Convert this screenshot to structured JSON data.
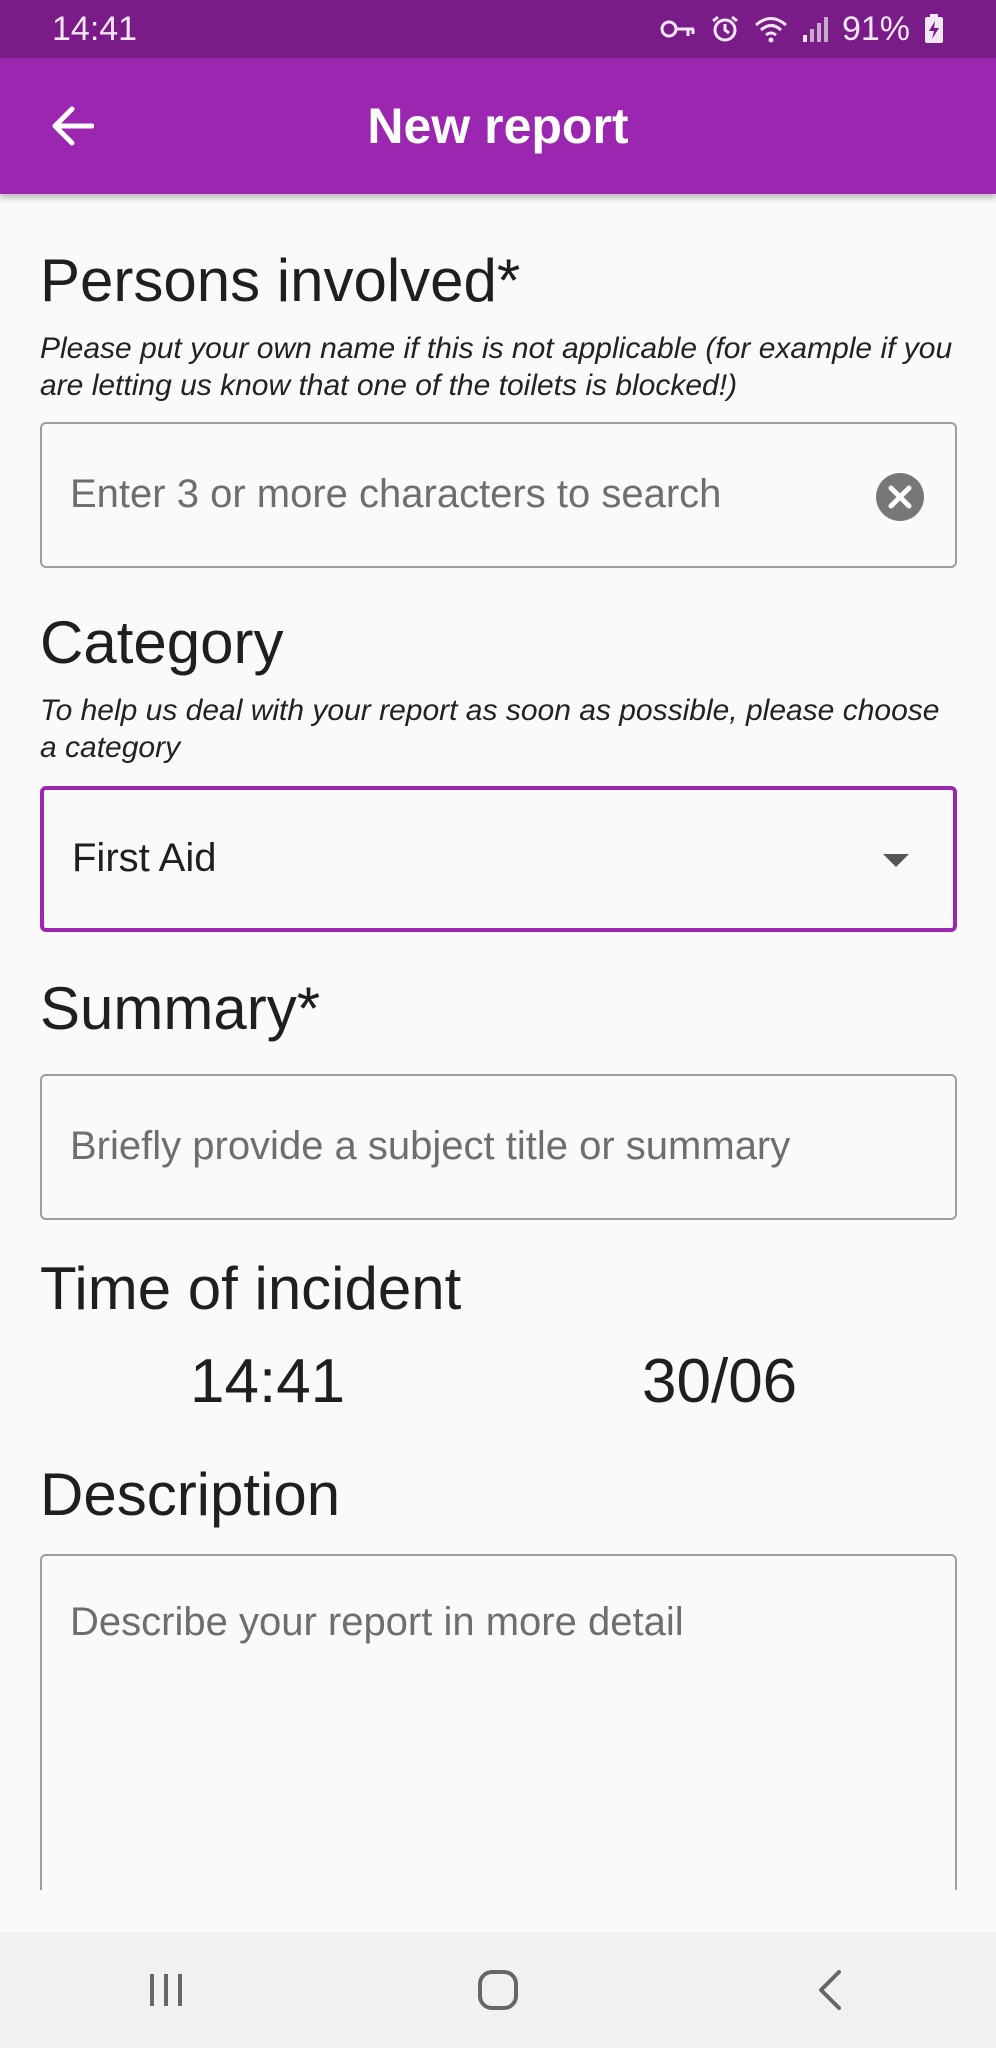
{
  "status": {
    "time": "14:41",
    "battery": "91%"
  },
  "app_bar": {
    "title": "New report"
  },
  "persons": {
    "title": "Persons involved*",
    "hint": "Please put your own name if this is not applicable (for example if you are letting us know that one of the toilets is blocked!)",
    "placeholder": "Enter 3 or more characters to search"
  },
  "category": {
    "title": "Category",
    "hint": "To help us deal with your report as soon as possible, please choose a category",
    "selected": "First Aid"
  },
  "summary": {
    "title": "Summary*",
    "placeholder": "Briefly provide a subject title or summary"
  },
  "time_of_incident": {
    "title": "Time of incident",
    "time": "14:41",
    "date": "30/06"
  },
  "description": {
    "title": "Description",
    "placeholder": "Describe your report in more detail"
  },
  "colors": {
    "status_bar": "#7a1c87",
    "app_bar": "#9b27b0",
    "focus_border": "#9b27b0"
  }
}
